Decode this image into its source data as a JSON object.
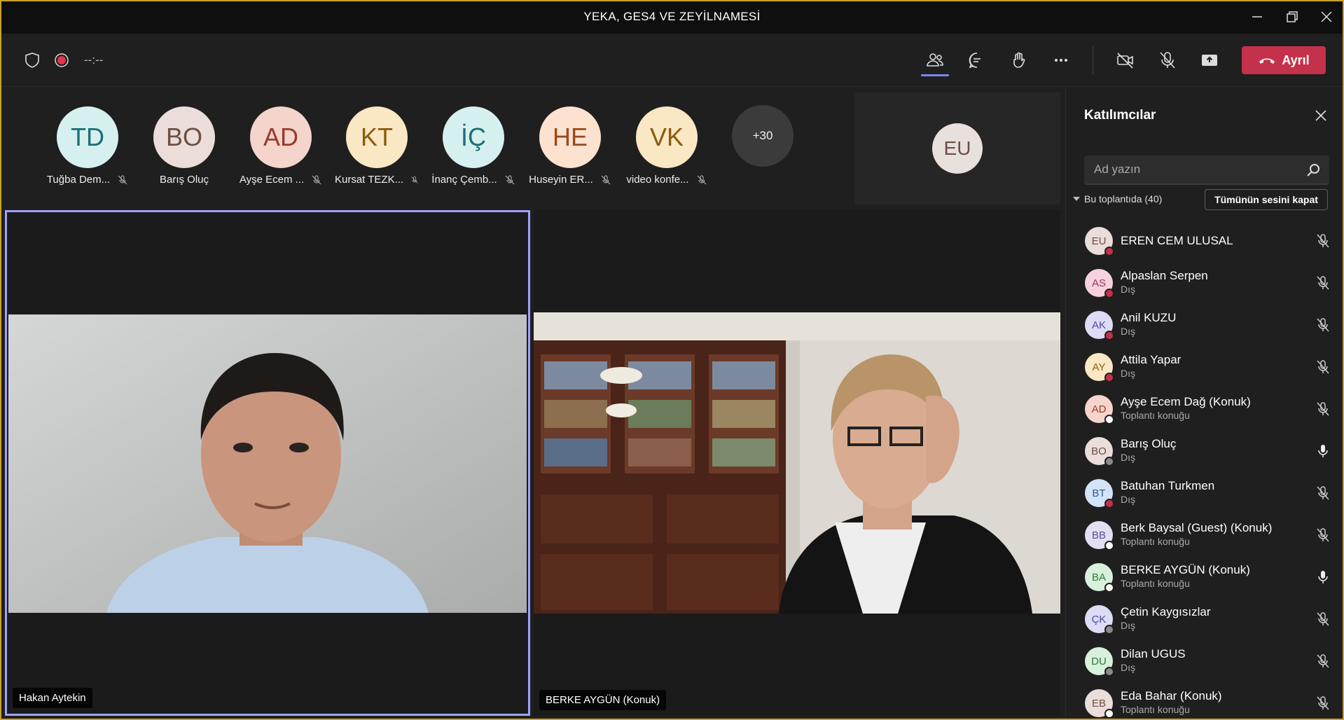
{
  "window": {
    "title": "YEKA, GES4 VE ZEYİLNAMESİ"
  },
  "meeting_bar": {
    "timer": "--:--",
    "leave_label": "Ayrıl",
    "leave_color": "#c4314b",
    "icons": [
      "shield-icon",
      "record-icon",
      "people-icon",
      "chat-icon",
      "raise-hand-icon",
      "more-icon",
      "camera-off-icon",
      "mic-off-icon",
      "share-icon"
    ]
  },
  "avatars": [
    {
      "initials": "TD",
      "name": "Tuğba Dem...",
      "bg": "#d6f0f0",
      "fg": "#1b6f74"
    },
    {
      "initials": "BO",
      "name": "Barış Oluç",
      "bg": "#eaddda",
      "fg": "#6d4f42"
    },
    {
      "initials": "AD",
      "name": "Ayşe Ecem ...",
      "bg": "#f5d4cc",
      "fg": "#9a3b2b"
    },
    {
      "initials": "KT",
      "name": "Kursat TEZK...",
      "bg": "#fae8c4",
      "fg": "#8a5b0d"
    },
    {
      "initials": "İÇ",
      "name": "İnanç Çemb...",
      "bg": "#d6f0f0",
      "fg": "#1b6f74"
    },
    {
      "initials": "HE",
      "name": "Huseyin ER...",
      "bg": "#fde2d0",
      "fg": "#9a4a1c"
    },
    {
      "initials": "VK",
      "name": "video konfe...",
      "bg": "#fae8c4",
      "fg": "#8a5b0d"
    }
  ],
  "overflow_count": "+30",
  "self_view": {
    "initials": "EU"
  },
  "tiles": [
    {
      "name": "Hakan Aytekin"
    },
    {
      "name": "BERKE AYGÜN (Konuk)"
    }
  ],
  "panel": {
    "title": "Katılımcılar",
    "search_placeholder": "Ad yazın",
    "section_label": "Bu toplantıda (40)",
    "mute_all_label": "Tümünün sesini kapat",
    "participants": [
      {
        "initials": "EU",
        "name": "EREN CEM ULUSAL",
        "sub": "",
        "bg": "#eaddda",
        "fg": "#6d4f42",
        "status": "#c4314b",
        "mic": "muted"
      },
      {
        "initials": "AS",
        "name": "Alpaslan Serpen",
        "sub": "Dış",
        "bg": "#f6d2e0",
        "fg": "#a3305a",
        "status": "#c4314b",
        "mic": "muted"
      },
      {
        "initials": "AK",
        "name": "Anil KUZU",
        "sub": "Dış",
        "bg": "#dcdcf5",
        "fg": "#4a4aa0",
        "status": "#c4314b",
        "mic": "muted"
      },
      {
        "initials": "AY",
        "name": "Attila Yapar",
        "sub": "Dış",
        "bg": "#fae8c4",
        "fg": "#8a5b0d",
        "status": "#c4314b",
        "mic": "muted"
      },
      {
        "initials": "AD",
        "name": "Ayşe Ecem Dağ (Konuk)",
        "sub": "Toplantı konuğu",
        "bg": "#f5d4cc",
        "fg": "#9a3b2b",
        "status": "#ffffff",
        "mic": "muted"
      },
      {
        "initials": "BO",
        "name": "Barış Oluç",
        "sub": "Dış",
        "bg": "#eaddda",
        "fg": "#6d4f42",
        "status": "#8a8a8a",
        "mic": "on"
      },
      {
        "initials": "BT",
        "name": "Batuhan Turkmen",
        "sub": "Dış",
        "bg": "#d4e4f7",
        "fg": "#2b5a99",
        "status": "#c4314b",
        "mic": "muted"
      },
      {
        "initials": "BB",
        "name": "Berk Baysal (Guest) (Konuk)",
        "sub": "Toplantı konuğu",
        "bg": "#e2dff2",
        "fg": "#55508f",
        "status": "#ffffff",
        "mic": "muted"
      },
      {
        "initials": "BA",
        "name": "BERKE AYGÜN (Konuk)",
        "sub": "Toplantı konuğu",
        "bg": "#d8f0dc",
        "fg": "#2e7a3c",
        "status": "#ffffff",
        "mic": "on"
      },
      {
        "initials": "ÇK",
        "name": "Çetin Kaygısızlar",
        "sub": "Dış",
        "bg": "#dcdcf5",
        "fg": "#4a4aa0",
        "status": "#8a8a8a",
        "mic": "muted"
      },
      {
        "initials": "DU",
        "name": "Dilan UGUS",
        "sub": "Dış",
        "bg": "#d8f0dc",
        "fg": "#2e7a3c",
        "status": "#8a8a8a",
        "mic": "muted"
      },
      {
        "initials": "EB",
        "name": "Eda Bahar (Konuk)",
        "sub": "Toplantı konuğu",
        "bg": "#eaddda",
        "fg": "#6d4f42",
        "status": "#ffffff",
        "mic": "muted"
      }
    ]
  }
}
